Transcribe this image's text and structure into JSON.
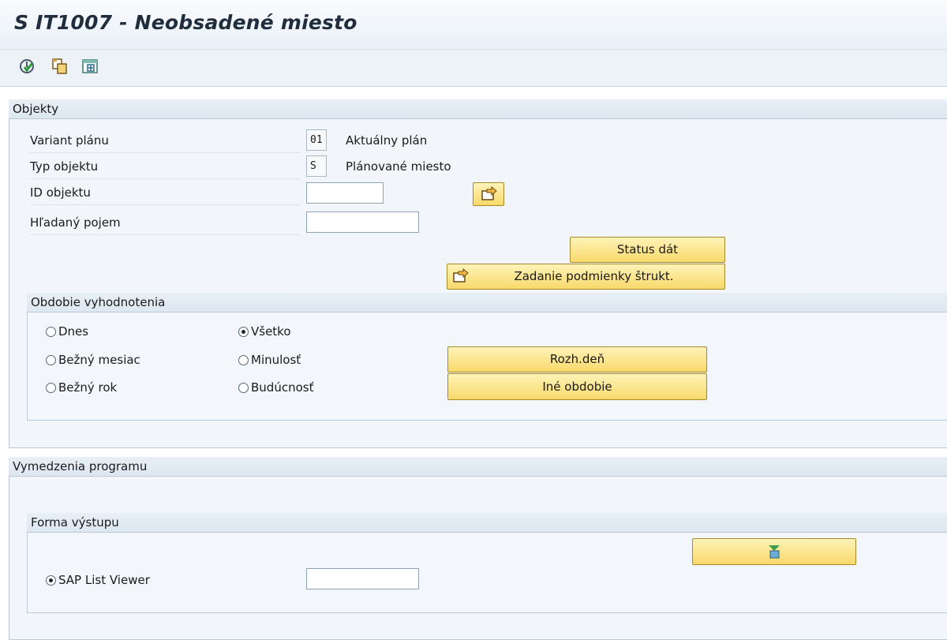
{
  "window": {
    "title": "S IT1007 - Neobsadené miesto"
  },
  "toolbar": {
    "icons": [
      "execute-icon",
      "copy-icon",
      "get-variant-icon"
    ]
  },
  "objects": {
    "header": "Objekty",
    "plan_variant_label": "Variant plánu",
    "plan_variant_value": "01",
    "plan_variant_text": "Aktuálny plán",
    "object_type_label": "Typ objektu",
    "object_type_value": "S",
    "object_type_text": "Plánované miesto",
    "object_id_label": "ID objektu",
    "object_id_value": "",
    "search_term_label": "Hľadaný pojem",
    "search_term_value": "",
    "data_status_button": "Status dát",
    "structure_condition_button": "Zadanie podmienky štrukt."
  },
  "evaluation_period": {
    "header": "Obdobie vyhodnotenia",
    "options": [
      {
        "label": "Dnes",
        "selected": false
      },
      {
        "label": "Bežný mesiac",
        "selected": false
      },
      {
        "label": "Bežný rok",
        "selected": false
      },
      {
        "label": "Všetko",
        "selected": true
      },
      {
        "label": "Minulosť",
        "selected": false
      },
      {
        "label": "Budúcnosť",
        "selected": false
      }
    ],
    "key_date_button": "Rozh.deň",
    "other_period_button": "Iné obdobie"
  },
  "program_selections": {
    "header": "Vymedzenia programu",
    "output_form": {
      "header": "Forma výstupu",
      "alv_label": "SAP List Viewer",
      "alv_selected": true,
      "layout_value": ""
    }
  },
  "colors": {
    "button_bg": "#f8d96a",
    "group_bg": "#f2f6fa",
    "header_bg": "#dde7f1",
    "title_text": "#1f2d3d"
  }
}
